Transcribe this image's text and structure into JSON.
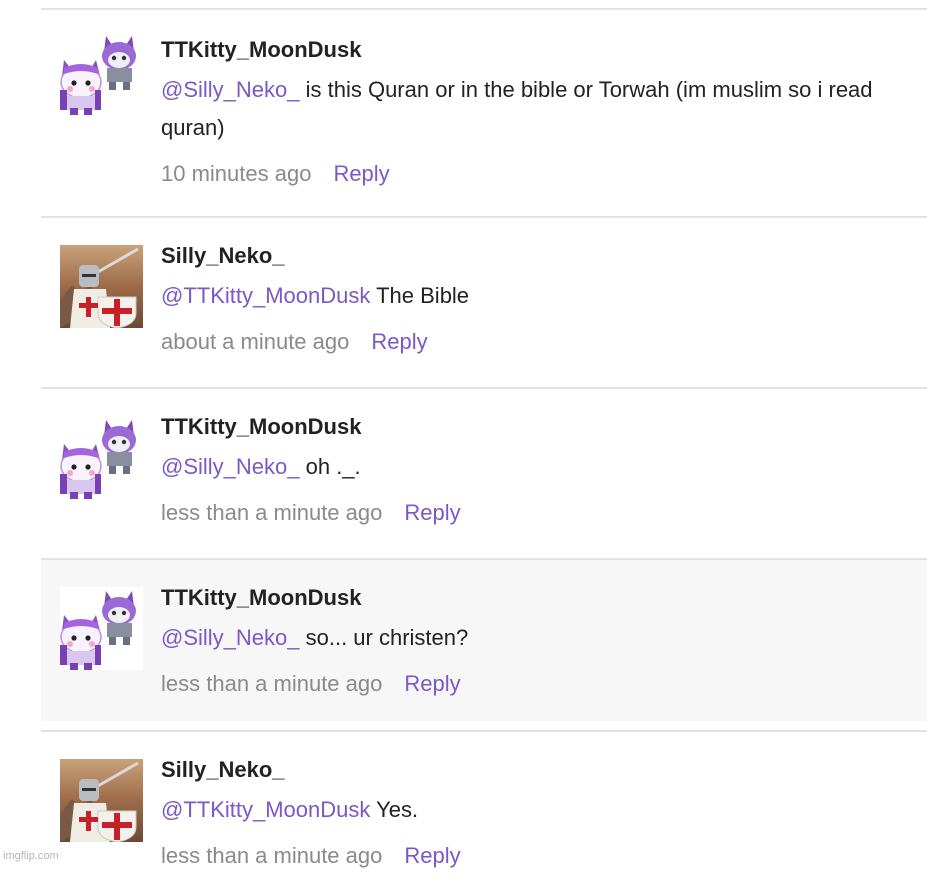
{
  "comments": [
    {
      "author": "TTKitty_MoonDusk",
      "avatar": "kitty-avatar-icon",
      "mention": "@Silly_Neko_",
      "text": " is this Quran or in the bible or Torwah (im muslim so i read quran)",
      "time": "10 minutes ago",
      "reply": "Reply"
    },
    {
      "author": "Silly_Neko_",
      "avatar": "crusader-knight-avatar-icon",
      "mention": "@TTKitty_MoonDusk",
      "text": " The Bible",
      "time": "about a minute ago",
      "reply": "Reply"
    },
    {
      "author": "TTKitty_MoonDusk",
      "avatar": "kitty-avatar-icon",
      "mention": "@Silly_Neko_",
      "text": " oh ._.",
      "time": "less than a minute ago",
      "reply": "Reply"
    },
    {
      "author": "TTKitty_MoonDusk",
      "avatar": "kitty-avatar-icon",
      "mention": "@Silly_Neko_",
      "text": " so... ur christen?",
      "time": "less than a minute ago",
      "reply": "Reply"
    },
    {
      "author": "Silly_Neko_",
      "avatar": "crusader-knight-avatar-icon",
      "mention": "@TTKitty_MoonDusk",
      "text": " Yes.",
      "time": "less than a minute ago",
      "reply": "Reply"
    }
  ],
  "watermark": "imgflip.com",
  "colors": {
    "mention": "#7a58c8",
    "reply": "#7a58c8",
    "time": "#8a8a8a",
    "author": "#222222",
    "divider": "#e2e2e2",
    "highlight_bg": "#f7f7f7"
  }
}
